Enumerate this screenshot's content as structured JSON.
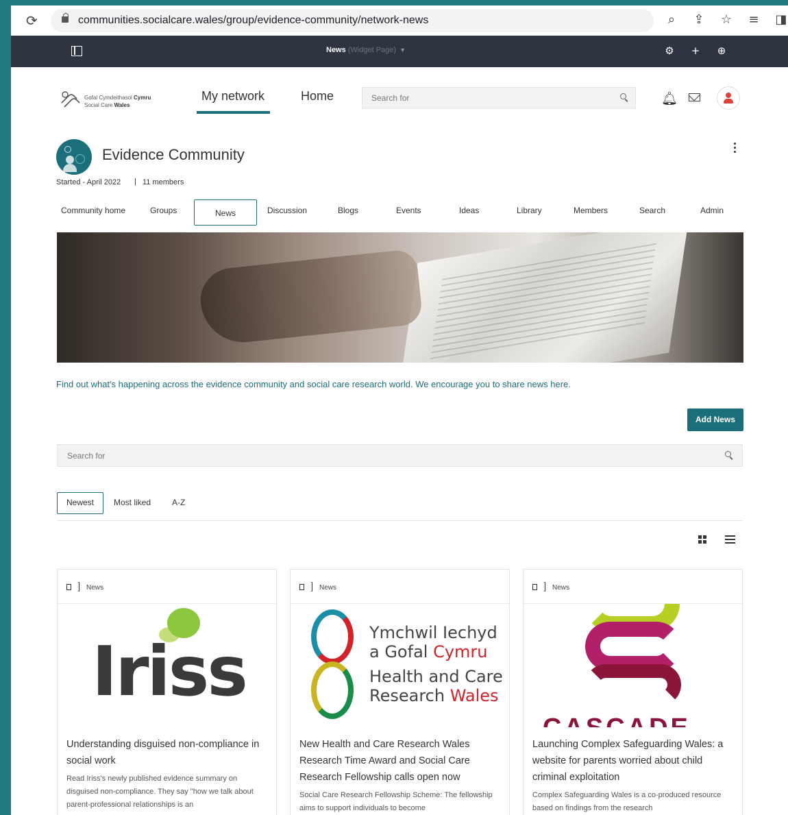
{
  "browser": {
    "url": "communities.socialcare.wales/group/evidence-community/network-news",
    "icons": [
      "reload-icon",
      "lock-icon",
      "zoom-icon",
      "share-icon",
      "star-icon",
      "reading-list-icon",
      "side-panel-icon"
    ]
  },
  "admin_bar": {
    "page_name": "News",
    "page_type": "(Widget Page)"
  },
  "site": {
    "logo_line1_welsh": "Gofal Cymdeithasol ",
    "logo_line1_bold": "Cymru",
    "logo_line2": "Social Care ",
    "logo_line2_bold": "Wales",
    "nav": [
      "My network",
      "Home"
    ],
    "search_placeholder": "Search for"
  },
  "community": {
    "title": "Evidence Community",
    "started": "Started - April 2022",
    "separator": "|",
    "members": "11 members",
    "tabs": [
      "Community home",
      "Groups",
      "News",
      "Discussion",
      "Blogs",
      "Events",
      "Ideas",
      "Library",
      "Members",
      "Search",
      "Admin"
    ],
    "active_tab": "News"
  },
  "news": {
    "intro": "Find out what's happening across the evidence community and social care research world. We encourage you to share news here.",
    "add_button": "Add News",
    "search_placeholder": "Search for",
    "sort_options": [
      "Newest",
      "Most liked",
      "A-Z"
    ],
    "active_sort": "Newest",
    "cards": [
      {
        "tag": "News",
        "logo_text": "Iriss",
        "title": "Understanding disguised non-compliance in social work",
        "description": "Read Iriss's newly published evidence summary on disguised non-compliance. They say \"how we talk about parent-professional relationships is an"
      },
      {
        "tag": "News",
        "logo_lines": [
          "Ymchwil Iechyd",
          "a Gofal ",
          "Cymru",
          "Health and Care",
          "Research ",
          "Wales"
        ],
        "title": "New Health and Care Research Wales Research Time Award and Social Care Research Fellowship calls open now",
        "description": "Social Care Research Fellowship Scheme: The fellowship aims to support individuals to become"
      },
      {
        "tag": "News",
        "logo_text": "CASCADE",
        "title": "Launching Complex Safeguarding Wales: a website for parents worried about child criminal exploitation",
        "description": "Complex Safeguarding Wales is a co-produced resource based on findings from the research"
      }
    ]
  },
  "colors": {
    "teal": "#1b6f7a",
    "admin_bar": "#2e3440",
    "background_frame": "#1f7a82"
  }
}
